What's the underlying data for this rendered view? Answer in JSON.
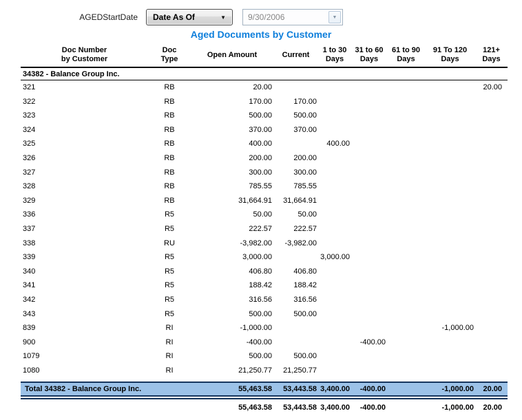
{
  "param_bar": {
    "label": "AGEDStartDate",
    "operator_dropdown": {
      "value": "Date As Of"
    },
    "date_input": {
      "value": "9/30/2006"
    }
  },
  "title": "Aged Documents by Customer",
  "colors": {
    "title_blue": "#0d7edb",
    "total_row_bg": "#9cc2e8",
    "total_row_border": "#17365d"
  },
  "table": {
    "columns": [
      {
        "l1": "Doc Number",
        "l2": "by Customer"
      },
      {
        "l1": "Doc",
        "l2": "Type"
      },
      {
        "l1": "Open Amount",
        "l2": ""
      },
      {
        "l1": "Current",
        "l2": ""
      },
      {
        "l1": "1 to 30",
        "l2": "Days"
      },
      {
        "l1": "31 to 60",
        "l2": "Days"
      },
      {
        "l1": "61 to 90",
        "l2": "Days"
      },
      {
        "l1": "91 To 120",
        "l2": "Days"
      },
      {
        "l1": "121+",
        "l2": "Days"
      }
    ],
    "group_header": "34382 - Balance Group Inc.",
    "rows": [
      [
        "321",
        "RB",
        "20.00",
        "",
        "",
        "",
        "",
        "",
        "20.00"
      ],
      [
        "322",
        "RB",
        "170.00",
        "170.00",
        "",
        "",
        "",
        "",
        ""
      ],
      [
        "323",
        "RB",
        "500.00",
        "500.00",
        "",
        "",
        "",
        "",
        ""
      ],
      [
        "324",
        "RB",
        "370.00",
        "370.00",
        "",
        "",
        "",
        "",
        ""
      ],
      [
        "325",
        "RB",
        "400.00",
        "",
        "400.00",
        "",
        "",
        "",
        ""
      ],
      [
        "326",
        "RB",
        "200.00",
        "200.00",
        "",
        "",
        "",
        "",
        ""
      ],
      [
        "327",
        "RB",
        "300.00",
        "300.00",
        "",
        "",
        "",
        "",
        ""
      ],
      [
        "328",
        "RB",
        "785.55",
        "785.55",
        "",
        "",
        "",
        "",
        ""
      ],
      [
        "329",
        "RB",
        "31,664.91",
        "31,664.91",
        "",
        "",
        "",
        "",
        ""
      ],
      [
        "336",
        "R5",
        "50.00",
        "50.00",
        "",
        "",
        "",
        "",
        ""
      ],
      [
        "337",
        "R5",
        "222.57",
        "222.57",
        "",
        "",
        "",
        "",
        ""
      ],
      [
        "338",
        "RU",
        "-3,982.00",
        "-3,982.00",
        "",
        "",
        "",
        "",
        ""
      ],
      [
        "339",
        "R5",
        "3,000.00",
        "",
        "3,000.00",
        "",
        "",
        "",
        ""
      ],
      [
        "340",
        "R5",
        "406.80",
        "406.80",
        "",
        "",
        "",
        "",
        ""
      ],
      [
        "341",
        "R5",
        "188.42",
        "188.42",
        "",
        "",
        "",
        "",
        ""
      ],
      [
        "342",
        "R5",
        "316.56",
        "316.56",
        "",
        "",
        "",
        "",
        ""
      ],
      [
        "343",
        "R5",
        "500.00",
        "500.00",
        "",
        "",
        "",
        "",
        ""
      ],
      [
        "839",
        "RI",
        "-1,000.00",
        "",
        "",
        "",
        "",
        "-1,000.00",
        ""
      ],
      [
        "900",
        "RI",
        "-400.00",
        "",
        "",
        "-400.00",
        "",
        "",
        ""
      ],
      [
        "1079",
        "RI",
        "500.00",
        "500.00",
        "",
        "",
        "",
        "",
        ""
      ],
      [
        "1080",
        "RI",
        "21,250.77",
        "21,250.77",
        "",
        "",
        "",
        "",
        ""
      ]
    ],
    "total_row": [
      "Total 34382 - Balance Group Inc.",
      "",
      "55,463.58",
      "53,443.58",
      "3,400.00",
      "-400.00",
      "",
      "-1,000.00",
      "20.00"
    ],
    "grand_total_row": [
      "",
      "",
      "55,463.58",
      "53,443.58",
      "3,400.00",
      "-400.00",
      "",
      "-1,000.00",
      "20.00"
    ]
  }
}
